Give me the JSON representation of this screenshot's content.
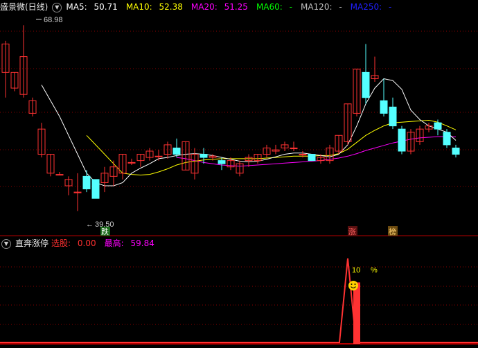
{
  "main_header": {
    "title": "盛景微(日线)",
    "ma5": {
      "label": "MA5:",
      "value": "50.71",
      "color": "#ffffff"
    },
    "ma10": {
      "label": "MA10:",
      "value": "52.38",
      "color": "#ffff00"
    },
    "ma20": {
      "label": "MA20:",
      "value": "51.25",
      "color": "#ff00ff"
    },
    "ma60": {
      "label": "MA60:",
      "value": "-",
      "color": "#00ff00"
    },
    "ma120": {
      "label": "MA120:",
      "value": "-",
      "color": "#c0c0c0"
    },
    "ma250": {
      "label": "MA250:",
      "value": "-",
      "color": "#0000ff"
    }
  },
  "sub_header": {
    "title": "直奔涨停",
    "xuangu": {
      "label": "选股:",
      "value": "0.00",
      "color": "#ff3030"
    },
    "zuigao": {
      "label": "最高:",
      "value": "59.84",
      "color": "#ff00ff"
    }
  },
  "annotations": {
    "high": "68.98",
    "low": "39.50",
    "die": "跌",
    "zhang": "涨",
    "bang": "榜",
    "pct_value": "10",
    "pct_sign": "%"
  },
  "colors": {
    "up": "#ff3232",
    "down": "#54ffff",
    "grid": "#8b0000",
    "border": "#b40000"
  },
  "chart_data": {
    "type": "candlestick",
    "y_range": [
      38,
      71
    ],
    "candles": [
      [
        61.5,
        66.0,
        57.5,
        66.5
      ],
      [
        59.0,
        61.5,
        58.5,
        61.5
      ],
      [
        58.0,
        64.0,
        57.5,
        68.98
      ],
      [
        55.0,
        57.0,
        54.5,
        57.5
      ],
      [
        48.5,
        52.5,
        48.0,
        53.5
      ],
      [
        45.5,
        48.5,
        45.0,
        48.5
      ],
      [
        45.3,
        45.3,
        45.3,
        45.7
      ],
      [
        43.5,
        44.5,
        42.0,
        45.0
      ],
      [
        42.5,
        42.5,
        39.5,
        45.5
      ],
      [
        45.0,
        43.0,
        42.5,
        46.0
      ],
      [
        44.5,
        41.5,
        41.5,
        44.5
      ],
      [
        44.0,
        45.5,
        42.5,
        46.5
      ],
      [
        45.0,
        46.5,
        43.5,
        47.5
      ],
      [
        45.5,
        48.5,
        44.5,
        48.5
      ],
      [
        47.2,
        47.2,
        46.8,
        47.8
      ],
      [
        47.5,
        48.5,
        46.5,
        48.5
      ],
      [
        48.0,
        49.0,
        47.5,
        49.5
      ],
      [
        48.2,
        48.2,
        47.5,
        49.2
      ],
      [
        48.5,
        50.0,
        47.8,
        50.5
      ],
      [
        49.5,
        48.5,
        48.0,
        51.0
      ],
      [
        46.0,
        50.5,
        46.0,
        50.5
      ],
      [
        45.5,
        48.5,
        44.5,
        49.5
      ],
      [
        48.5,
        48.0,
        47.0,
        49.5
      ],
      [
        48.0,
        48.2,
        47.5,
        48.5
      ],
      [
        47.5,
        47.0,
        46.0,
        48.0
      ],
      [
        46.5,
        47.5,
        46.0,
        48.0
      ],
      [
        45.5,
        47.0,
        45.0,
        47.5
      ],
      [
        47.5,
        48.0,
        46.5,
        48.5
      ],
      [
        47.5,
        48.5,
        47.0,
        48.5
      ],
      [
        48.5,
        49.5,
        48.0,
        50.0
      ],
      [
        49.0,
        49.2,
        48.5,
        50.0
      ],
      [
        49.5,
        50.0,
        49.0,
        50.5
      ],
      [
        49.5,
        49.5,
        49.0,
        50.5
      ],
      [
        48.5,
        48.5,
        48.0,
        49.0
      ],
      [
        48.5,
        47.5,
        47.5,
        48.5
      ],
      [
        47.5,
        48.0,
        47.0,
        48.5
      ],
      [
        47.5,
        49.5,
        47.0,
        50.0
      ],
      [
        49.0,
        51.5,
        48.5,
        51.5
      ],
      [
        50.5,
        56.5,
        50.0,
        56.5
      ],
      [
        55.0,
        62.0,
        54.5,
        62.0
      ],
      [
        61.5,
        57.5,
        56.5,
        66.0
      ],
      [
        60.5,
        61.0,
        60.0,
        64.0
      ],
      [
        57.0,
        55.0,
        54.5,
        60.5
      ],
      [
        56.0,
        53.0,
        52.5,
        57.5
      ],
      [
        52.5,
        49.0,
        48.5,
        53.0
      ],
      [
        49.0,
        52.0,
        48.5,
        52.5
      ],
      [
        50.5,
        52.5,
        50.0,
        53.0
      ],
      [
        52.5,
        53.0,
        52.0,
        53.5
      ],
      [
        53.5,
        52.5,
        51.5,
        54.0
      ],
      [
        52.0,
        50.0,
        49.5,
        52.5
      ],
      [
        49.5,
        48.5,
        48.0,
        50.0
      ]
    ],
    "ma5": [
      null,
      null,
      null,
      null,
      59.5,
      57.0,
      54.5,
      51.5,
      48.5,
      45.5,
      44.0,
      43.5,
      43.5,
      44.0,
      45.5,
      46.3,
      47.0,
      47.8,
      48.0,
      48.3,
      48.5,
      48.6,
      48.5,
      48.3,
      48.0,
      47.7,
      47.4,
      47.3,
      47.4,
      47.7,
      48.1,
      48.5,
      48.7,
      48.7,
      48.5,
      48.3,
      48.1,
      48.5,
      50.0,
      53.0,
      56.5,
      59.0,
      60.5,
      60.2,
      58.8,
      55.5,
      54.0,
      53.0,
      52.5,
      52.0,
      50.71
    ],
    "ma10": [
      null,
      null,
      null,
      null,
      null,
      null,
      null,
      null,
      null,
      51.5,
      50.0,
      48.5,
      47.0,
      45.5,
      45.3,
      45.2,
      45.3,
      45.7,
      46.2,
      46.8,
      47.2,
      47.4,
      47.6,
      47.7,
      47.8,
      47.8,
      47.8,
      47.8,
      47.8,
      47.9,
      48.0,
      48.1,
      48.2,
      48.2,
      48.2,
      48.3,
      48.3,
      48.6,
      49.3,
      50.4,
      51.5,
      52.3,
      53.0,
      53.5,
      53.6,
      53.7,
      53.8,
      53.9,
      53.6,
      53.0,
      52.38
    ],
    "ma20": [
      null,
      null,
      null,
      null,
      null,
      null,
      null,
      null,
      null,
      null,
      null,
      null,
      null,
      null,
      null,
      null,
      null,
      null,
      null,
      48.0,
      47.8,
      47.5,
      47.2,
      47.0,
      46.8,
      46.7,
      46.6,
      46.7,
      46.8,
      46.9,
      47.0,
      47.1,
      47.2,
      47.3,
      47.4,
      47.5,
      47.7,
      47.9,
      48.2,
      48.6,
      49.1,
      49.5,
      49.9,
      50.3,
      50.6,
      50.9,
      51.1,
      51.2,
      51.3,
      51.3,
      51.25
    ],
    "signal": {
      "peak_index": 38,
      "peak_value": 59.84,
      "bar_index": 39,
      "bar_value": 10,
      "sub_y_range": [
        0,
        66
      ]
    }
  }
}
